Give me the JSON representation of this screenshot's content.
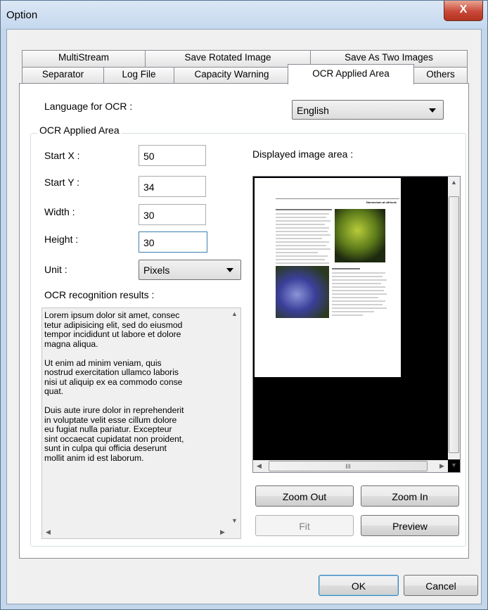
{
  "window": {
    "title": "Option",
    "close_glyph": "X"
  },
  "tabs": {
    "row1": [
      {
        "label": "MultiStream"
      },
      {
        "label": "Save Rotated Image"
      },
      {
        "label": "Save As Two Images"
      }
    ],
    "row2": [
      {
        "label": "Separator"
      },
      {
        "label": "Log File"
      },
      {
        "label": "Capacity Warning"
      },
      {
        "label": "OCR Applied Area"
      },
      {
        "label": "Others"
      }
    ],
    "active": "OCR Applied Area"
  },
  "language": {
    "label": "Language for OCR :",
    "value": "English"
  },
  "area": {
    "group_title": "OCR Applied Area",
    "start_x": {
      "label": "Start X :",
      "value": "50"
    },
    "start_y": {
      "label": "Start Y :",
      "value": "34"
    },
    "width": {
      "label": "Width :",
      "value": "30"
    },
    "height": {
      "label": "Height :",
      "value": "30"
    },
    "unit": {
      "label": "Unit :",
      "value": "Pixels"
    }
  },
  "results": {
    "label": "OCR recognition results :",
    "text": "Lorem ipsum dolor sit amet, consec\ntetur adipisicing elit, sed do eiusmod\ntempor incididunt ut labore et dolore\nmagna aliqua.\n\nUt enim ad minim veniam, quis\nnostrud exercitation ullamco laboris\nnisi ut aliquip ex ea commodo conse\nquat.\n\nDuis aute irure dolor in reprehenderit\nin voluptate velit esse cillum dolore\neu fugiat nulla pariatur. Excepteur\nsint occaecat cupidatat non proident,\nsunt in culpa qui officia deserunt\nmollit anim id est laborum."
  },
  "preview": {
    "label": "Displayed image area :",
    "doc_heading": "Nonsectum at ultricule",
    "scroll_thumb_glyph": "III"
  },
  "buttons": {
    "zoom_out": "Zoom Out",
    "zoom_in": "Zoom In",
    "fit": "Fit",
    "preview": "Preview",
    "ok": "OK",
    "cancel": "Cancel"
  },
  "icons": {
    "close": "close-icon",
    "dropdown": "chevron-down-icon",
    "scroll_up": "scroll-up-arrow-icon",
    "scroll_down": "scroll-down-arrow-icon",
    "scroll_left": "scroll-left-arrow-icon",
    "scroll_right": "scroll-right-arrow-icon"
  },
  "colors": {
    "title_bar": "#c5d8ee",
    "close_button": "#c9483a",
    "focus_border": "#3c7fb1",
    "dialog_bg": "#f0f0f0"
  }
}
